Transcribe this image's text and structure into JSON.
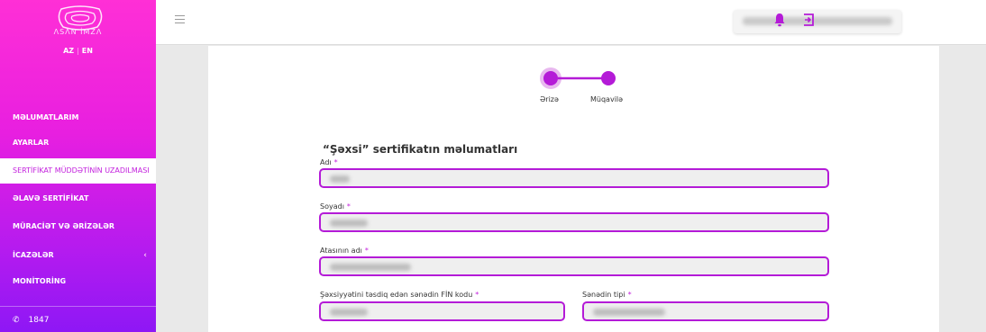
{
  "brand": {
    "logo_text": "ΛSΛN İMZΛ"
  },
  "language": {
    "az": "AZ",
    "separator": "|",
    "en": "EN"
  },
  "sidebar": {
    "items": [
      {
        "label": "MƏLUMATLARIM"
      },
      {
        "label": "AYARLAR"
      },
      {
        "label": "SERTİFİKAT MÜDDƏTİNİN UZADILMASI",
        "active": true
      },
      {
        "label": "ƏLAVƏ SERTİFİKAT"
      },
      {
        "label": "MÜRACİƏT VƏ ƏRİZƏLƏR"
      },
      {
        "label": "İCAZƏLƏR",
        "chevron": "‹"
      },
      {
        "label": "MONİTORİNG"
      }
    ],
    "phone": "1847"
  },
  "topbar": {
    "menu_icon": "hamburger-icon",
    "notification_icon": "bell-icon",
    "logout_icon": "logout-icon"
  },
  "stepper": {
    "steps": [
      {
        "label": "Ərizə",
        "state": "current"
      },
      {
        "label": "Müqavilə",
        "state": "next"
      }
    ]
  },
  "form": {
    "title": "“Şəxsi” sertifikatın məlumatları",
    "required_mark": "*",
    "fields": [
      {
        "label": "Adı"
      },
      {
        "label": "Soyadı"
      },
      {
        "label": "Atasının adı"
      },
      {
        "label": "Şəxsiyyətini təsdiq edən sənədin FİN kodu"
      },
      {
        "label": "Sənədin tipi"
      }
    ]
  },
  "colors": {
    "accent": "#b41bd7",
    "sidebar_top": "#ff2fd6",
    "sidebar_bottom": "#8e17f5"
  }
}
